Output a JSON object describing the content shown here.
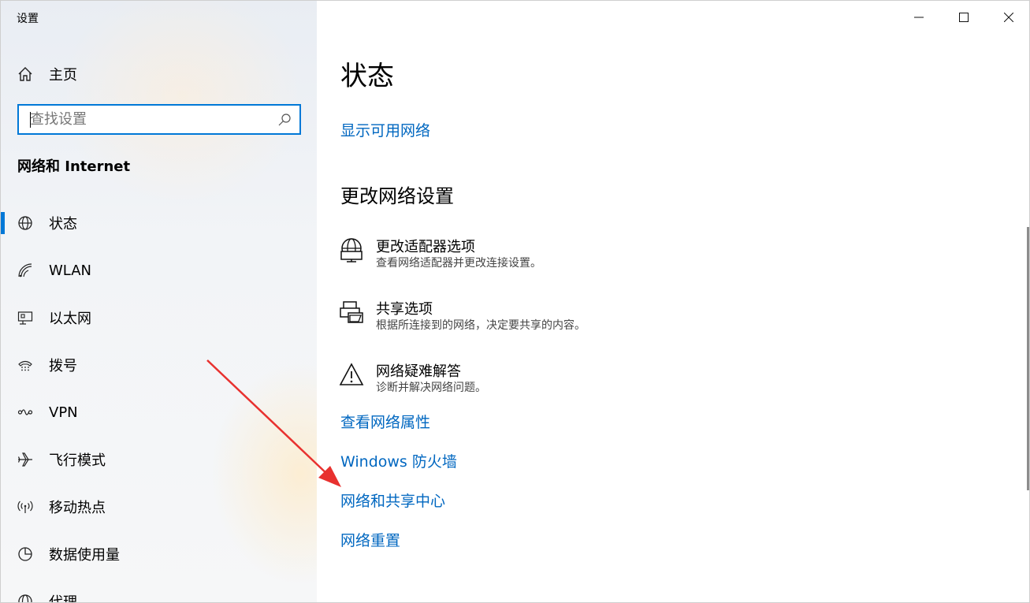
{
  "window": {
    "title": "设置"
  },
  "sidebar": {
    "home_label": "主页",
    "search_placeholder": "查找设置",
    "section_title": "网络和 Internet",
    "items": [
      {
        "label": "状态",
        "icon": "globe-icon",
        "active": true
      },
      {
        "label": "WLAN",
        "icon": "wifi-icon"
      },
      {
        "label": "以太网",
        "icon": "ethernet-icon"
      },
      {
        "label": "拨号",
        "icon": "dialup-icon"
      },
      {
        "label": "VPN",
        "icon": "vpn-icon"
      },
      {
        "label": "飞行模式",
        "icon": "airplane-icon"
      },
      {
        "label": "移动热点",
        "icon": "hotspot-icon"
      },
      {
        "label": "数据使用量",
        "icon": "data-usage-icon"
      },
      {
        "label": "代理",
        "icon": "proxy-icon"
      }
    ]
  },
  "main": {
    "title": "状态",
    "show_networks_link": "显示可用网络",
    "change_settings_title": "更改网络设置",
    "settings": [
      {
        "name": "更改适配器选项",
        "desc": "查看网络适配器并更改连接设置。",
        "icon": "adapter-icon"
      },
      {
        "name": "共享选项",
        "desc": "根据所连接到的网络，决定要共享的内容。",
        "icon": "sharing-icon"
      },
      {
        "name": "网络疑难解答",
        "desc": "诊断并解决网络问题。",
        "icon": "warning-icon"
      }
    ],
    "links": [
      "查看网络属性",
      "Windows 防火墙",
      "网络和共享中心",
      "网络重置"
    ]
  },
  "colors": {
    "accent": "#0078d7",
    "link": "#0067c0",
    "annotation_arrow": "#e8312f"
  }
}
